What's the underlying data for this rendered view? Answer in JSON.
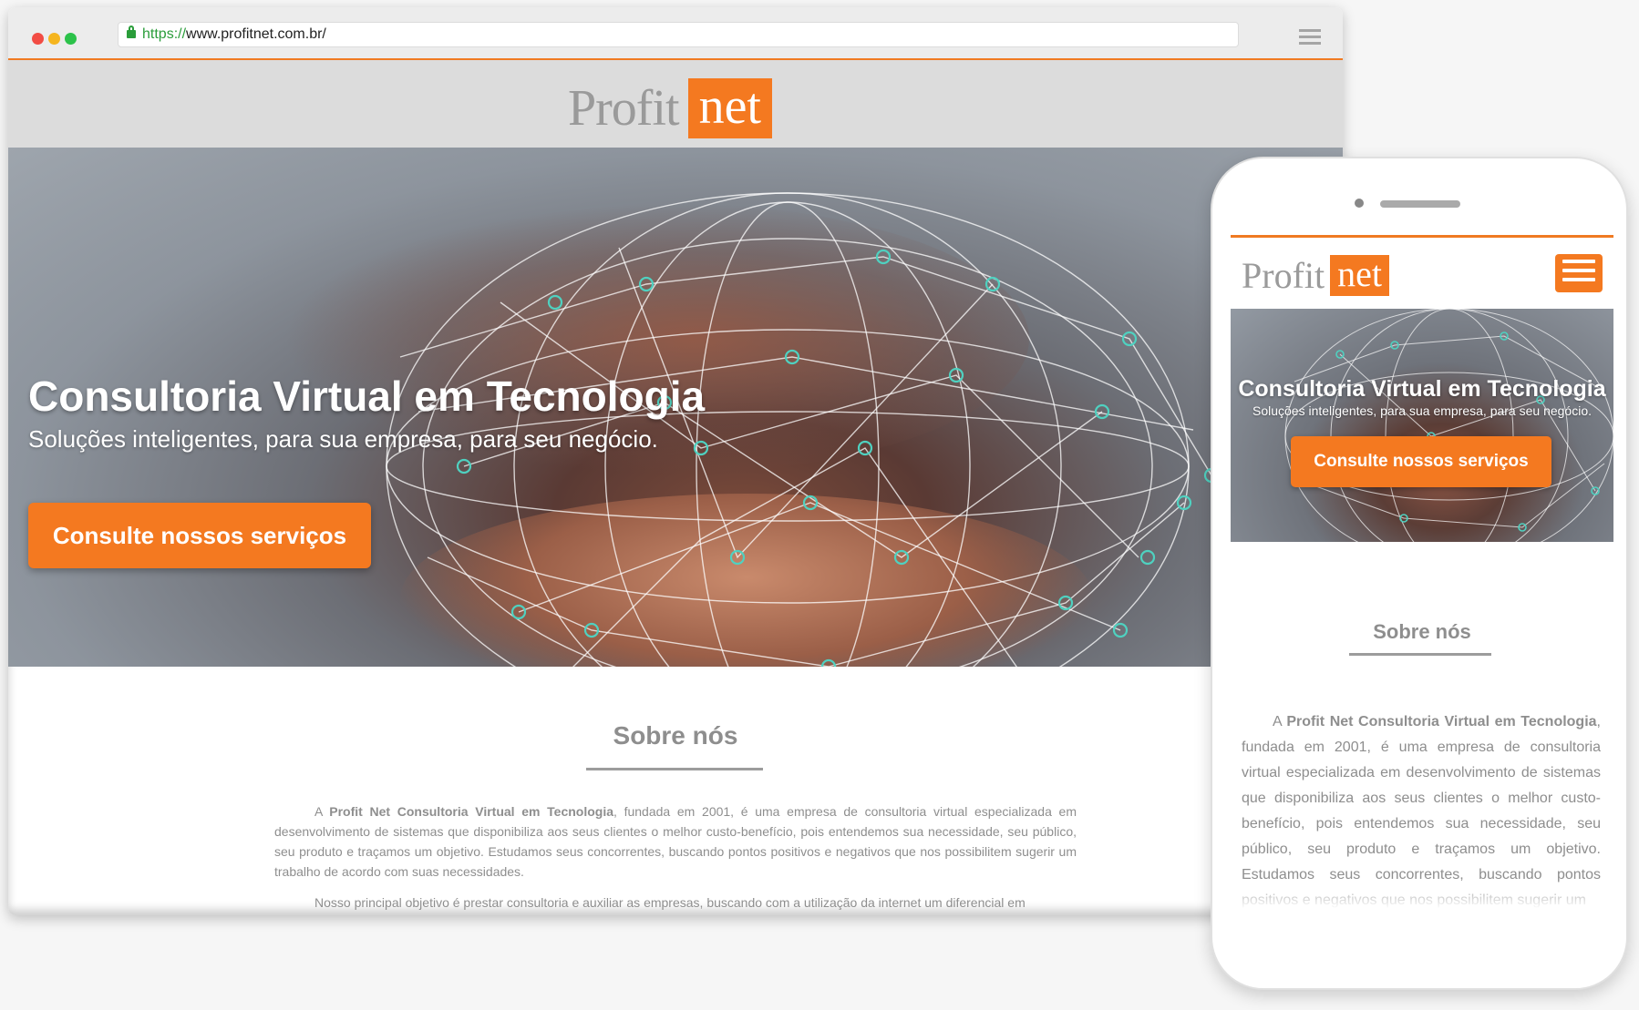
{
  "browser": {
    "url_scheme": "https://",
    "url_rest": "www.profitnet.com.br/"
  },
  "brand": {
    "logo_part1": "Profit",
    "logo_part2": "net",
    "accent_color": "#f47920"
  },
  "hero": {
    "title": "Consultoria Virtual em Tecnologia",
    "subtitle": "Soluções inteligentes, para sua empresa, para seu negócio.",
    "cta_label": "Consulte nossos serviços"
  },
  "about": {
    "title": "Sobre nós",
    "p1_prefix": "A ",
    "p1_bold": "Profit Net Consultoria Virtual em Tecnologia",
    "p1_rest": ", fundada em 2001, é uma empresa de consultoria virtual especializada em desenvolvimento de sistemas que disponibiliza aos seus clientes o melhor custo-benefício, pois entendemos sua necessidade, seu público, seu produto e traçamos um objetivo. Estudamos seus concorrentes, buscando pontos positivos e negativos que nos possibilitem sugerir um trabalho de acordo com suas necessidades.",
    "p2": "Nosso principal objetivo é prestar consultoria e auxiliar as empresas, buscando com a utilização da internet um diferencial em"
  },
  "mobile": {
    "about_p1_rest": ", fundada em 2001, é uma empresa de consultoria virtual especializada em desenvolvimento de sistemas que disponibiliza aos seus clientes o melhor custo-benefício, pois entendemos sua necessidade, seu público, seu produto e traçamos um objetivo. Estudamos seus concorrentes, buscando pontos positivos e negativos que nos possibilitem sugerir um"
  }
}
